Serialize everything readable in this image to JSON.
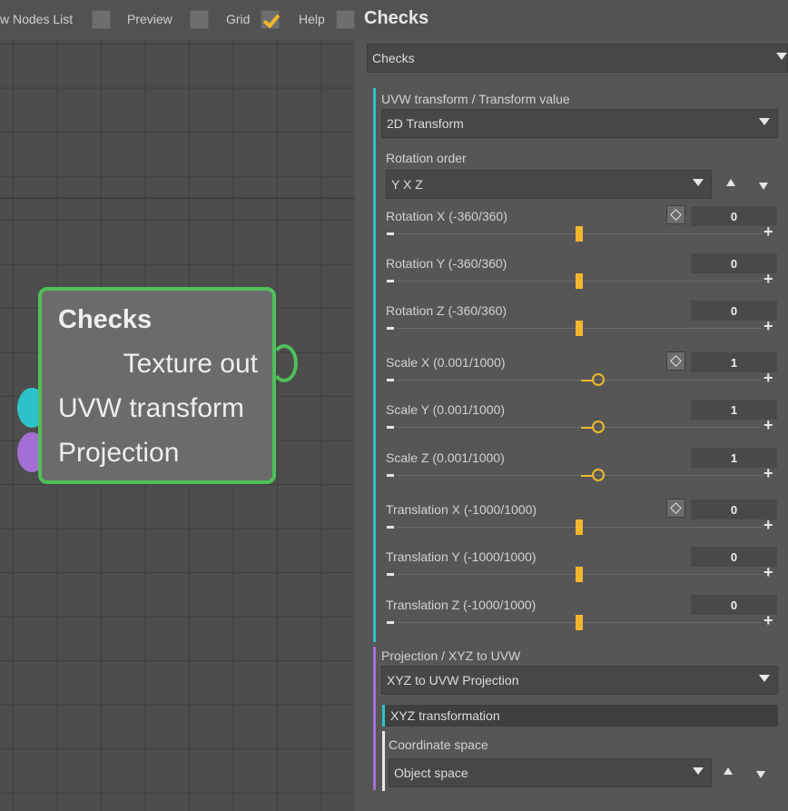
{
  "toolbar": {
    "nodes_list_label": "w Nodes List",
    "preview_label": "Preview",
    "grid_label": "Grid",
    "help_label": "Help",
    "title": "Checks",
    "nodes_list_checked": false,
    "preview_checked": false,
    "grid_checked": true,
    "help_checked": false
  },
  "node": {
    "title": "Checks",
    "output": "Texture out",
    "inputs": [
      "UVW transform",
      "Projection"
    ],
    "colors": {
      "border": "#4ec15a",
      "uvw_port": "#2fc1c9",
      "projection_port": "#a36fd5"
    }
  },
  "panel": {
    "node_select": "Checks",
    "uvw_section_label": "UVW transform / Transform value",
    "uvw_type": "2D Transform",
    "rotation_order_label": "Rotation order",
    "rotation_order_value": "Y X Z",
    "params": [
      {
        "label": "Rotation X (-360/360)",
        "value": "0",
        "has_key": true,
        "slider_fraction": 0.5,
        "style": "bar"
      },
      {
        "label": "Rotation Y (-360/360)",
        "value": "0",
        "has_key": false,
        "slider_fraction": 0.5,
        "style": "bar"
      },
      {
        "label": "Rotation Z (-360/360)",
        "value": "0",
        "has_key": false,
        "slider_fraction": 0.5,
        "style": "bar"
      },
      {
        "label": "Scale X (0.001/1000)",
        "value": "1",
        "has_key": true,
        "slider_fraction": 0.55,
        "style": "circle"
      },
      {
        "label": "Scale Y (0.001/1000)",
        "value": "1",
        "has_key": false,
        "slider_fraction": 0.55,
        "style": "circle"
      },
      {
        "label": "Scale Z (0.001/1000)",
        "value": "1",
        "has_key": false,
        "slider_fraction": 0.55,
        "style": "circle"
      },
      {
        "label": "Translation X (-1000/1000)",
        "value": "0",
        "has_key": true,
        "slider_fraction": 0.5,
        "style": "bar"
      },
      {
        "label": "Translation Y (-1000/1000)",
        "value": "0",
        "has_key": false,
        "slider_fraction": 0.5,
        "style": "bar"
      },
      {
        "label": "Translation Z (-1000/1000)",
        "value": "0",
        "has_key": false,
        "slider_fraction": 0.5,
        "style": "bar"
      }
    ],
    "projection_section_label": "Projection / XYZ to UVW",
    "projection_type": "XYZ to UVW Projection",
    "xyz_transformation_label": "XYZ transformation",
    "coordinate_space_label": "Coordinate space",
    "coordinate_space_value": "Object space"
  }
}
